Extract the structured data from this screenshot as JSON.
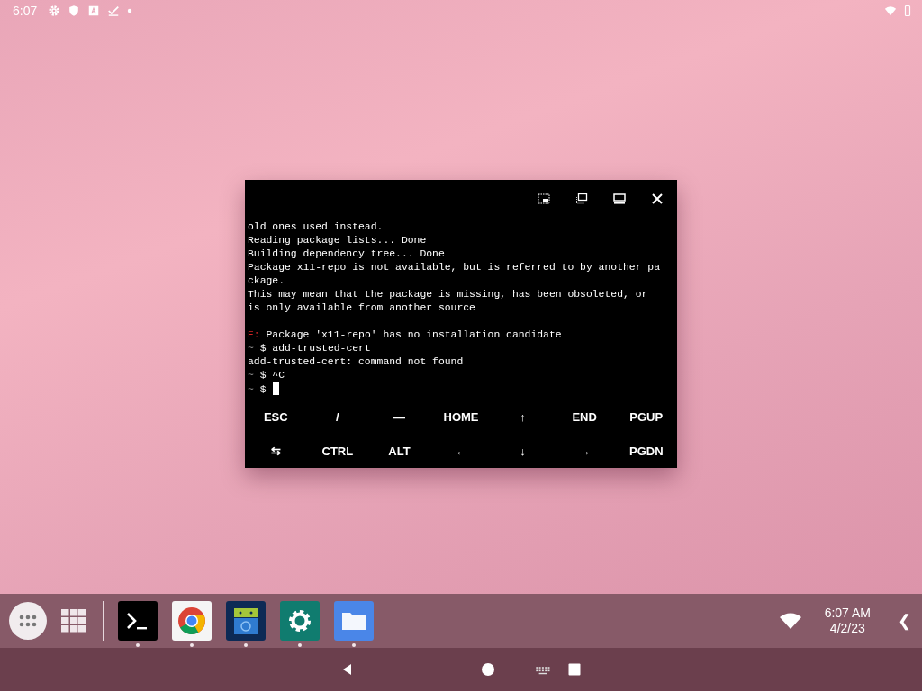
{
  "status_bar": {
    "time": "6:07"
  },
  "terminal": {
    "lines": [
      {
        "kind": "output",
        "text": "old ones used instead."
      },
      {
        "kind": "output",
        "text": "Reading package lists... Done"
      },
      {
        "kind": "output",
        "text": "Building dependency tree... Done"
      },
      {
        "kind": "output",
        "text": "Package x11-repo is not available, but is referred to by another pa"
      },
      {
        "kind": "output",
        "text": "ckage."
      },
      {
        "kind": "output",
        "text": "This may mean that the package is missing, has been obsoleted, or"
      },
      {
        "kind": "output",
        "text": "is only available from another source"
      },
      {
        "kind": "blank"
      },
      {
        "kind": "error",
        "prefix": "E:",
        "text": "Package 'x11-repo' has no installation candidate"
      },
      {
        "kind": "prompt",
        "prefix": "~",
        "text": "$ add-trusted-cert"
      },
      {
        "kind": "output",
        "text": "add-trusted-cert: command not found"
      },
      {
        "kind": "prompt",
        "prefix": "~",
        "text": "$ ^C"
      },
      {
        "kind": "prompt",
        "prefix": "~",
        "text": "$",
        "cursor": true
      }
    ],
    "extra_keys": [
      [
        "ESC",
        "/",
        "—",
        "HOME",
        "↑",
        "END",
        "PGUP"
      ],
      [
        "⇆",
        "CTRL",
        "ALT",
        "←",
        "↓",
        "→",
        "PGDN"
      ]
    ]
  },
  "taskbar": {
    "apps": [
      {
        "kind": "terminal",
        "running": true
      },
      {
        "kind": "browser",
        "running": true
      },
      {
        "kind": "android",
        "running": true
      },
      {
        "kind": "settings",
        "running": true
      },
      {
        "kind": "files",
        "running": true
      }
    ],
    "time": "6:07 AM",
    "date": "4/2/23",
    "collapse": "❮"
  }
}
